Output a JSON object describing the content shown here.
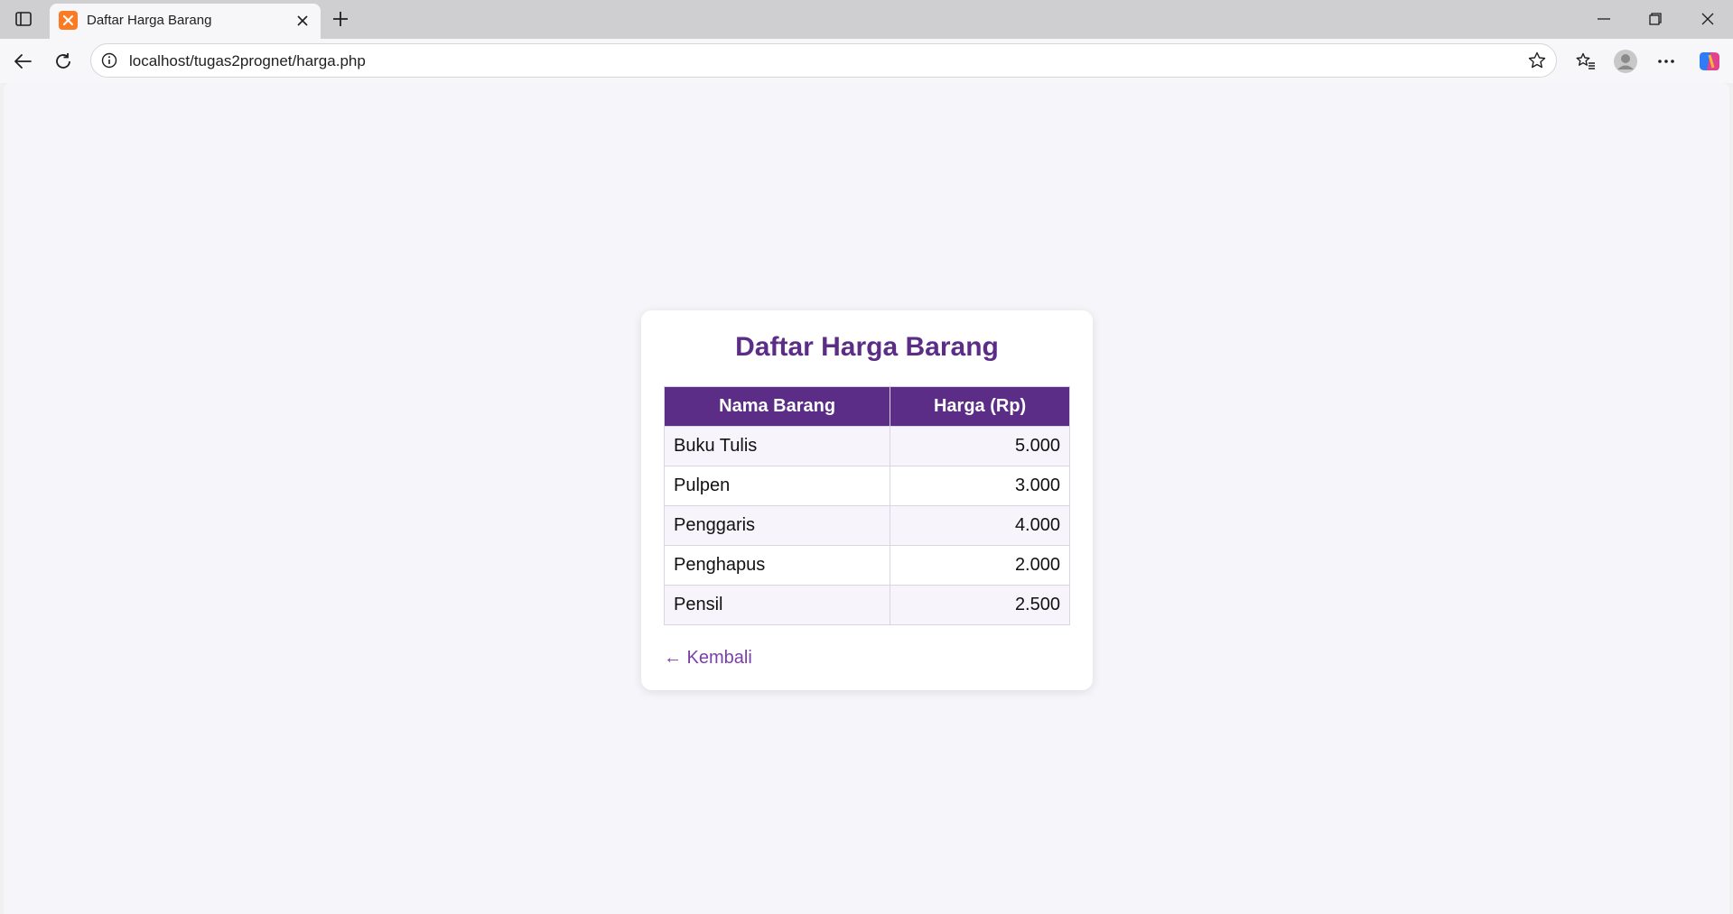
{
  "browser": {
    "tab_title": "Daftar Harga Barang",
    "url": "localhost/tugas2prognet/harga.php"
  },
  "page": {
    "title": "Daftar Harga Barang",
    "table": {
      "headers": [
        "Nama Barang",
        "Harga (Rp)"
      ],
      "rows": [
        {
          "name": "Buku Tulis",
          "price": "5.000"
        },
        {
          "name": "Pulpen",
          "price": "3.000"
        },
        {
          "name": "Penggaris",
          "price": "4.000"
        },
        {
          "name": "Penghapus",
          "price": "2.000"
        },
        {
          "name": "Pensil",
          "price": "2.500"
        }
      ]
    },
    "back_link": "← Kembali"
  },
  "colors": {
    "accent": "#5c2d86",
    "link": "#7a3fa8",
    "page_bg": "#f6f5fa"
  }
}
